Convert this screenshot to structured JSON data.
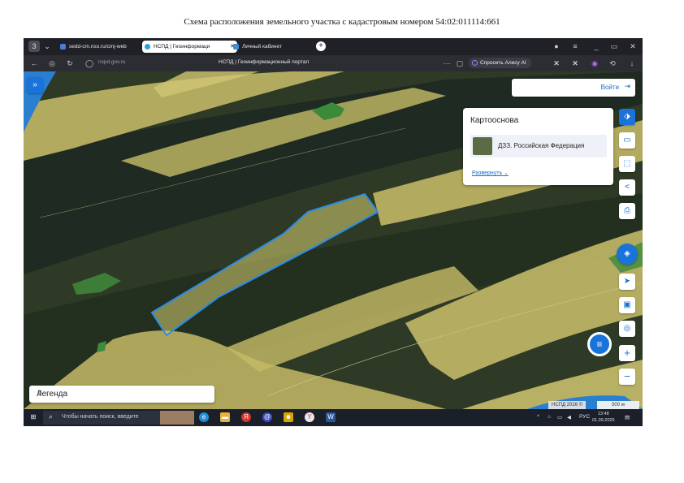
{
  "document_title": "Схема расположения земельного участка с кадастровым номером 54:02:011114:661",
  "browser": {
    "profile_badge": "3",
    "tabs": [
      {
        "label": "sedd-cm.nso.ru/cmj-web",
        "active": false
      },
      {
        "label": "НСПД | Геоинформаци",
        "active": true
      },
      {
        "label": "Личный кабинет",
        "active": false
      }
    ],
    "url": "nspd.gov.ru",
    "page_title": "НСПД | Геоинформационный портал",
    "alice_label": "Спросить Алису AI",
    "window_controls": [
      "≡",
      "_",
      "▭",
      "✕"
    ]
  },
  "portal": {
    "login_label": "Войти",
    "basemap": {
      "heading": "Картооснова",
      "layer_label": "ДЗЗ. Российская Федерация",
      "expand_label": "Развернуть"
    },
    "legend_label": "Легенда",
    "attribution": "НСПД 2026 ©",
    "scale_label": "500 м",
    "toolbar_icons": [
      "layers-icon",
      "ruler-icon",
      "select-area-icon",
      "share-icon",
      "print-icon",
      "nspd-logo-icon",
      "locate-icon",
      "screenshot-icon",
      "geo-search-icon",
      "zoom-in-icon",
      "zoom-out-icon"
    ],
    "colors": {
      "parcel_fill": "#d8cf73",
      "parcel_outline": "#2a8de8",
      "accent": "#1a73d9"
    }
  },
  "taskbar": {
    "search_placeholder": "Чтобы начать поиск, введите",
    "language": "РУС",
    "time": "13:48",
    "date": "01.09.2026"
  }
}
